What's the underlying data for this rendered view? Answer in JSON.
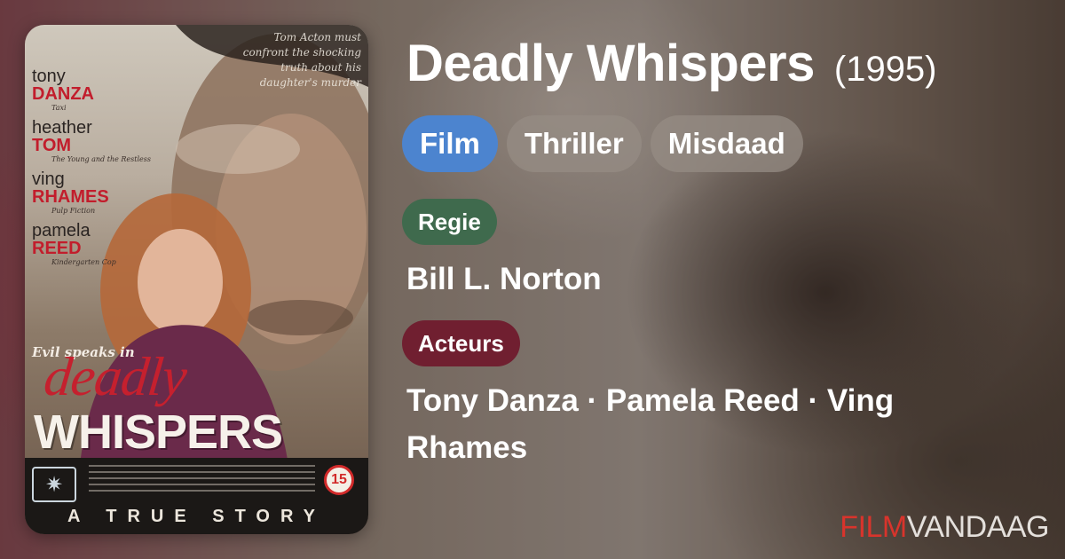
{
  "movie": {
    "title": "Deadly Whispers",
    "year": "(1995)"
  },
  "tags": [
    "Film",
    "Thriller",
    "Misdaad"
  ],
  "director": {
    "label": "Regie",
    "value": "Bill L. Norton"
  },
  "actors": {
    "label": "Acteurs",
    "value": "Tony Danza · Pamela Reed · Ving Rhames"
  },
  "brand": {
    "part1": "FILM",
    "part2": "VANDAAG"
  },
  "poster": {
    "tagline": "Tom Acton must confront the shocking truth about his daughter's murder",
    "credits": [
      {
        "first": "tony",
        "last": "danza",
        "role": "Taxi"
      },
      {
        "first": "heather",
        "last": "tom",
        "role": "The Young and the Restless"
      },
      {
        "first": "ving",
        "last": "rhames",
        "role": "Pulp Fiction"
      },
      {
        "first": "pamela",
        "last": "reed",
        "role": "Kindergarten Cop"
      }
    ],
    "evil_text": "Evil speaks in",
    "title_top": "deadly",
    "title_bottom": "WHISPERS",
    "rating": "15",
    "bottom_text": "A TRUE STORY"
  },
  "colors": {
    "tag_primary": "#4c84cf",
    "label_regie": "#3f6a4d",
    "label_acteurs": "#701f30",
    "brand_red": "#d8342c"
  }
}
